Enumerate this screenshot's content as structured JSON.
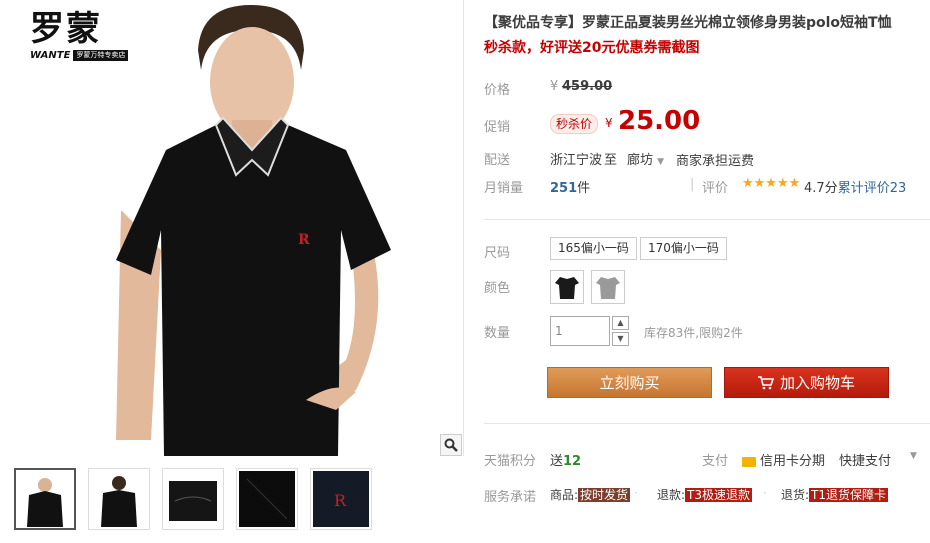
{
  "brand": {
    "logo_cn": "罗蒙",
    "logo_en": "WANTE",
    "logo_store": "罗蒙万特专卖店"
  },
  "product": {
    "title": "【聚优品专享】罗蒙正品夏装男丝光棉立领修身男装polo短袖T恤",
    "subtitle": "秒杀款，好评送20元优惠券需截图"
  },
  "price": {
    "label": "价格",
    "currency": "¥",
    "original": "459.00",
    "promo_label": "促销",
    "promo_badge": "秒杀价",
    "promo_price": "25.00"
  },
  "shipping": {
    "label": "配送",
    "from": "浙江宁波",
    "to_word": "至",
    "to": "廊坊",
    "fee": "商家承担运费"
  },
  "sales": {
    "label": "月销量",
    "count": "251",
    "unit": "件",
    "rating_label": "评价",
    "stars": "★★★★★",
    "score": "4.7分",
    "reviews": "累计评价23"
  },
  "options": {
    "size_label": "尺码",
    "sizes": [
      "165偏小一码",
      "170偏小一码"
    ],
    "color_label": "颜色",
    "colors": [
      "#1a1a1a",
      "#9a9a9a"
    ],
    "qty_label": "数量",
    "qty_value": "1",
    "stock": "库存83件,限购2件"
  },
  "buttons": {
    "buy": "立刻购买",
    "cart": "加入购物车"
  },
  "extras": {
    "points_label": "天猫积分",
    "points_give": "送",
    "points_value": "12",
    "pay_label": "支付",
    "credit": "信用卡分期",
    "quick": "快捷支付",
    "service_label": "服务承诺",
    "goods_label": "商品:",
    "goods_tag": "按时发货",
    "return_label": "退款:",
    "return_tag": "T3极速退款",
    "exchange_label": "退货:",
    "exchange_tag": "T1退货保障卡"
  },
  "colors": {
    "accent": "#c40000",
    "buy": "#d38a44",
    "cart": "#c4240f"
  }
}
